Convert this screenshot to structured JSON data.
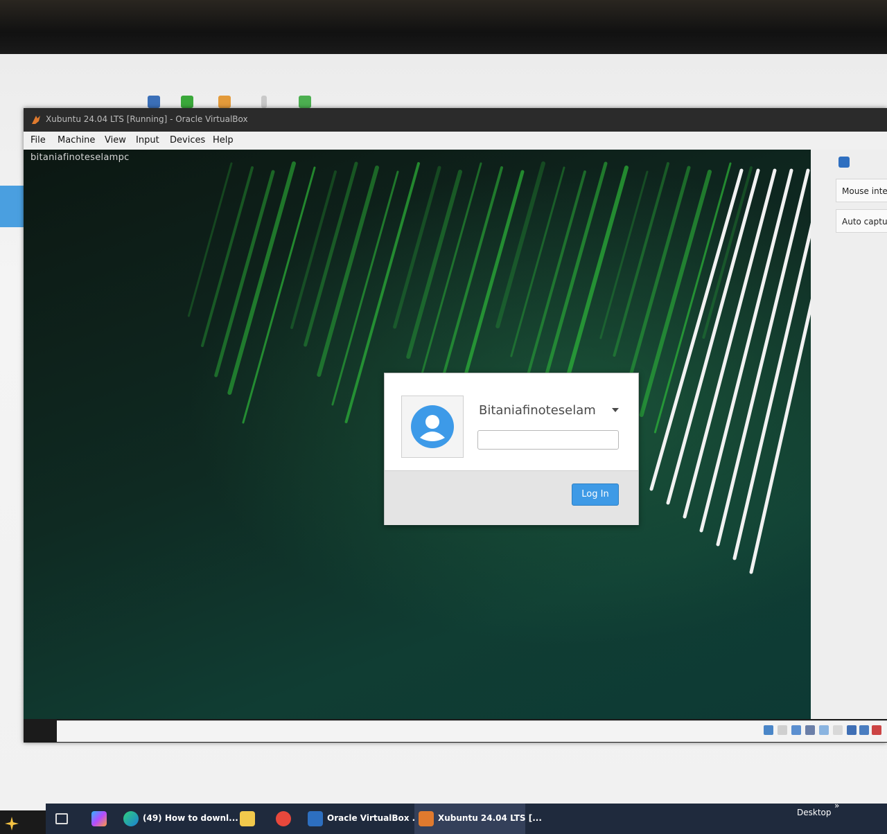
{
  "vbox": {
    "title": "Xubuntu 24.04 LTS [Running] - Oracle VirtualBox",
    "menu": [
      "File",
      "Machine",
      "View",
      "Input",
      "Devices",
      "Help"
    ]
  },
  "guest": {
    "hostname": "bitaniafinoteselampc",
    "login": {
      "username": "Bitaniafinoteselam",
      "password_value": "",
      "button_label": "Log In"
    }
  },
  "notifications": {
    "items": [
      "Mouse inte",
      "Auto captu"
    ]
  },
  "taskbar": {
    "items": [
      {
        "label": "(49) How to downl...",
        "icon": "edge-icon"
      },
      {
        "label": "Oracle VirtualBox ...",
        "icon": "virtualbox-icon"
      },
      {
        "label": "Xubuntu 24.04 LTS [...",
        "icon": "virtualbox-vm-icon"
      }
    ],
    "desktop_label": "Desktop",
    "chevron": "»"
  },
  "colors": {
    "accent": "#3e9ae6",
    "taskbar": "#1f2a3d",
    "wallpaper_green": "#2fbf3a"
  }
}
